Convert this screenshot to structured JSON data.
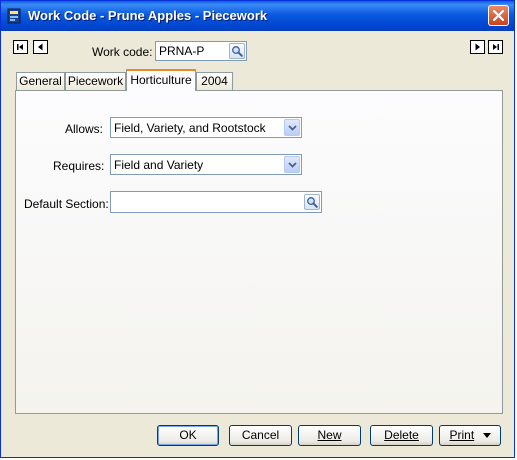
{
  "window": {
    "title": "Work Code - Prune Apples - Piecework"
  },
  "header": {
    "work_code_label": "Work code:",
    "work_code_value": "PRNA-P"
  },
  "tabs": [
    {
      "label": "General"
    },
    {
      "label": "Piecework"
    },
    {
      "label": "Horticulture"
    },
    {
      "label": "2004"
    }
  ],
  "active_tab": "Horticulture",
  "form": {
    "allows_label": "Allows:",
    "allows_value": "Field, Variety, and Rootstock",
    "requires_label": "Requires:",
    "requires_value": "Field and Variety",
    "default_section_label": "Default Section:",
    "default_section_value": ""
  },
  "buttons": {
    "ok": "OK",
    "cancel": "Cancel",
    "new": "New",
    "delete": "Delete",
    "print": "Print"
  },
  "colors": {
    "title_bar": "#0a5ae0",
    "window_bg": "#ece9d8",
    "active_tab_accent": "#e68b2c",
    "close_button": "#c6431d"
  },
  "icons": {
    "first": "first-record-icon",
    "prev": "previous-record-icon",
    "next": "next-record-icon",
    "last": "last-record-icon",
    "lookup": "magnifier-icon",
    "dropdown": "chevron-down-icon",
    "close": "close-icon"
  }
}
